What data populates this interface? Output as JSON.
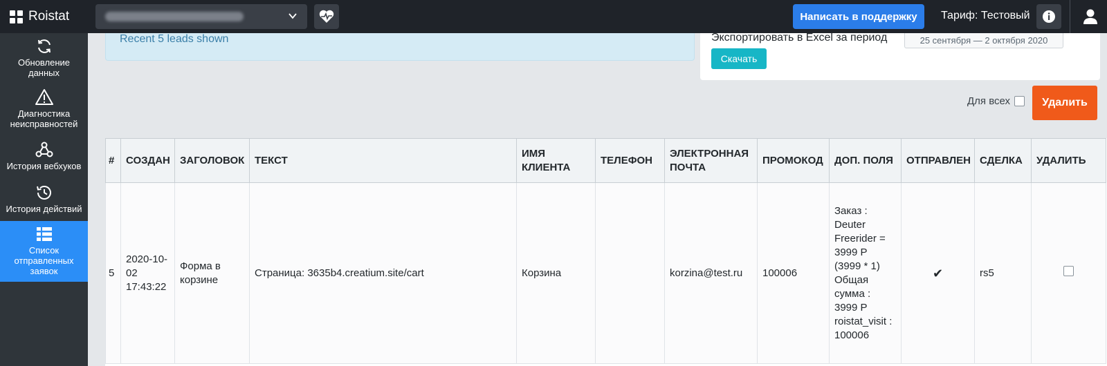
{
  "app": {
    "logo_text": "Roistat",
    "support_label": "Написать в поддержку",
    "tariff_label": "Тариф: Тестовый"
  },
  "sidebar": {
    "items": [
      {
        "label": "Обновление данных",
        "icon": "refresh-icon"
      },
      {
        "label": "Диагностика неисправностей",
        "icon": "warning-icon"
      },
      {
        "label": "История вебхуков",
        "icon": "webhook-icon"
      },
      {
        "label": "История действий",
        "icon": "history-icon"
      },
      {
        "label": "Список отправленных заявок",
        "icon": "list-icon",
        "active": true
      }
    ]
  },
  "alert": {
    "text": "Recent 5 leads shown"
  },
  "export": {
    "label": "Экспортировать в Excel за период",
    "date_range": "25 сентября — 2 октября 2020",
    "download_label": "Скачать"
  },
  "controls": {
    "for_all_label": "Для всех",
    "delete_label": "Удалить"
  },
  "table": {
    "columns": [
      "#",
      "Создан",
      "Заголовок",
      "Текст",
      "Имя клиента",
      "Телефон",
      "Электронная почта",
      "Промокод",
      "Доп. поля",
      "Отправлен",
      "Сделка",
      "Удалить"
    ],
    "rows": [
      {
        "num": "5",
        "created": "2020-10-02 17:43:22",
        "title": "Форма в корзине",
        "text": "Страница: 3635b4.creatium.site/cart",
        "client_name": "Корзина",
        "phone": "",
        "email": "korzina@test.ru",
        "promo": "100006",
        "extra": "Заказ : Deuter Freerider = 3999 Р (3999 * 1) Общая сумма : 3999 Р roistat_visit : 100006",
        "sent": "✔",
        "deal": "rs5"
      }
    ]
  },
  "colors": {
    "topbar": "#1f2329",
    "sidebar": "#2f353a",
    "active": "#2b8ef7",
    "support": "#2b7de9",
    "download": "#17b6c6",
    "delete": "#f05a1a"
  }
}
